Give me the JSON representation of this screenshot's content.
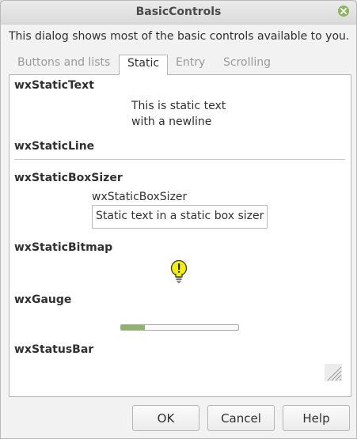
{
  "window": {
    "title": "BasicControls"
  },
  "intro_text": "This dialog shows most of the basic controls available to you.",
  "tabs": [
    {
      "label": "Buttons and lists",
      "active": false
    },
    {
      "label": "Static",
      "active": true
    },
    {
      "label": "Entry",
      "active": false
    },
    {
      "label": "Scrolling",
      "active": false
    }
  ],
  "panel": {
    "static_text": {
      "heading": "wxStaticText",
      "line1": "This is static text",
      "line2": "with a newline"
    },
    "static_line": {
      "heading": "wxStaticLine"
    },
    "static_box_sizer": {
      "heading": "wxStaticBoxSizer",
      "box_label": "wxStaticBoxSizer",
      "box_text": "Static text in a static box sizer"
    },
    "static_bitmap": {
      "heading": "wxStaticBitmap",
      "icon": "lightbulb-icon"
    },
    "gauge": {
      "heading": "wxGauge",
      "value_fraction": 0.2,
      "fill_color": "#8eb46a"
    },
    "status_bar": {
      "heading": "wxStatusBar",
      "icon": "resize-grip-icon"
    }
  },
  "buttons": {
    "ok": "OK",
    "cancel": "Cancel",
    "help": "Help"
  },
  "colors": {
    "accent": "#8cb360",
    "bulb": "#f5f000"
  }
}
